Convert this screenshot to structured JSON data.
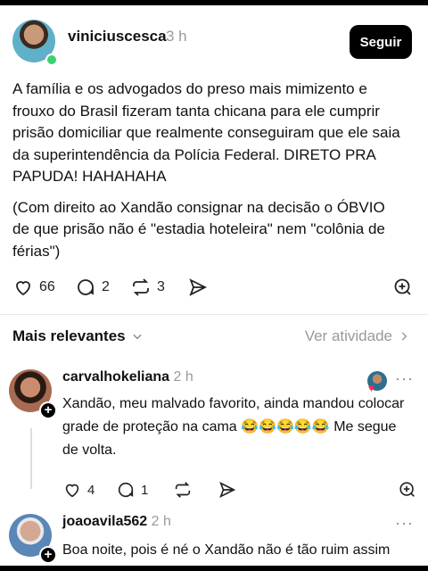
{
  "post": {
    "username": "viniciuscesca",
    "time": "3 h",
    "follow_label": "Seguir",
    "paragraphs": [
      "A família e os advogados do preso mais mimizento e frouxo do Brasil fizeram tanta chicana para ele cumprir prisão domiciliar que realmente conseguiram que ele saia da superintendência da Polícia Federal. DIRETO PRA PAPUDA! HAHAHAHA",
      "(Com direito ao Xandão consignar na decisão o ÓBVIO de que prisão não é \"estadia hoteleira\" nem \"colônia de férias\")"
    ],
    "likes": "66",
    "replies": "2",
    "reposts": "3"
  },
  "sort": {
    "label": "Mais relevantes",
    "activity_label": "Ver atividade"
  },
  "comments": [
    {
      "username": "carvalhokeliana",
      "time": "2 h",
      "text": "Xandão, meu malvado favorito, ainda mandou colocar grade de proteção na cama 😂😂😂😂😂 Me segue de volta.",
      "likes": "4",
      "replies": "1"
    },
    {
      "username": "joaoavila562",
      "time": "2 h",
      "text": "Boa noite, pois é né o Xandão não é tão ruim assim"
    }
  ],
  "icons": {
    "like": "heart-icon",
    "reply": "comment-icon",
    "repost": "repost-icon",
    "send": "send-icon",
    "quote": "quote-plus-icon"
  }
}
